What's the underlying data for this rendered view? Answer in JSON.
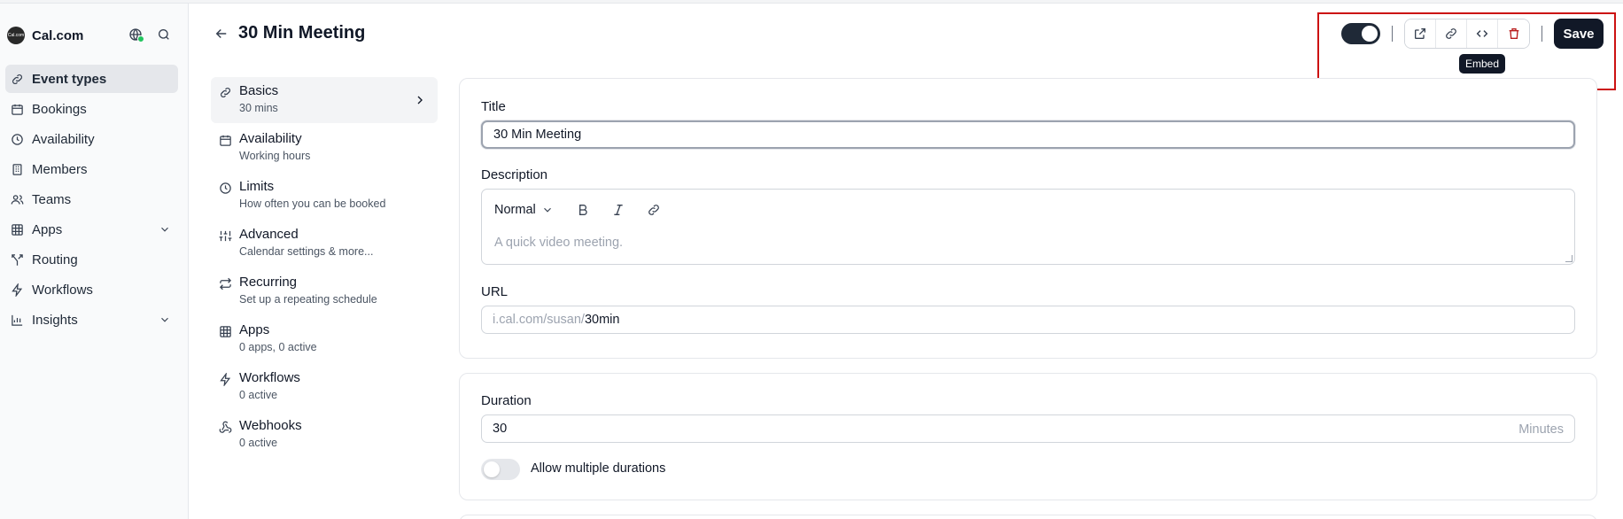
{
  "app": {
    "brand_name": "Cal.com",
    "brand_logo_text": "Cal.com"
  },
  "sidebar": {
    "items": [
      {
        "label": "Event types",
        "icon": "link-icon",
        "active": true
      },
      {
        "label": "Bookings",
        "icon": "calendar-icon"
      },
      {
        "label": "Availability",
        "icon": "clock-icon"
      },
      {
        "label": "Members",
        "icon": "building-icon"
      },
      {
        "label": "Teams",
        "icon": "users-icon"
      },
      {
        "label": "Apps",
        "icon": "grid-icon",
        "expandable": true
      },
      {
        "label": "Routing",
        "icon": "split-icon"
      },
      {
        "label": "Workflows",
        "icon": "zap-icon"
      },
      {
        "label": "Insights",
        "icon": "bar-chart-icon",
        "expandable": true
      }
    ]
  },
  "header": {
    "title": "30 Min Meeting",
    "save_label": "Save",
    "tooltip": "Embed"
  },
  "subnav": {
    "items": [
      {
        "title": "Basics",
        "desc": "30 mins",
        "icon": "link-icon",
        "active": true
      },
      {
        "title": "Availability",
        "desc": "Working hours",
        "icon": "calendar-icon"
      },
      {
        "title": "Limits",
        "desc": "How often you can be booked",
        "icon": "clock-icon"
      },
      {
        "title": "Advanced",
        "desc": "Calendar settings & more...",
        "icon": "sliders-icon"
      },
      {
        "title": "Recurring",
        "desc": "Set up a repeating schedule",
        "icon": "repeat-icon"
      },
      {
        "title": "Apps",
        "desc": "0 apps, 0 active",
        "icon": "grid-icon"
      },
      {
        "title": "Workflows",
        "desc": "0 active",
        "icon": "zap-icon"
      },
      {
        "title": "Webhooks",
        "desc": "0 active",
        "icon": "webhook-icon"
      }
    ]
  },
  "form": {
    "title_label": "Title",
    "title_value": "30 Min Meeting",
    "description_label": "Description",
    "format_value": "Normal",
    "description_placeholder": "A quick video meeting.",
    "url_label": "URL",
    "url_prefix": "i.cal.com/susan/",
    "url_value": "30min",
    "duration_label": "Duration",
    "duration_value": "30",
    "duration_suffix": "Minutes",
    "multiple_durations_label": "Allow multiple durations"
  },
  "colors": {
    "accent": "#111827",
    "highlight": "#cc1111",
    "danger": "#b91c1c"
  }
}
